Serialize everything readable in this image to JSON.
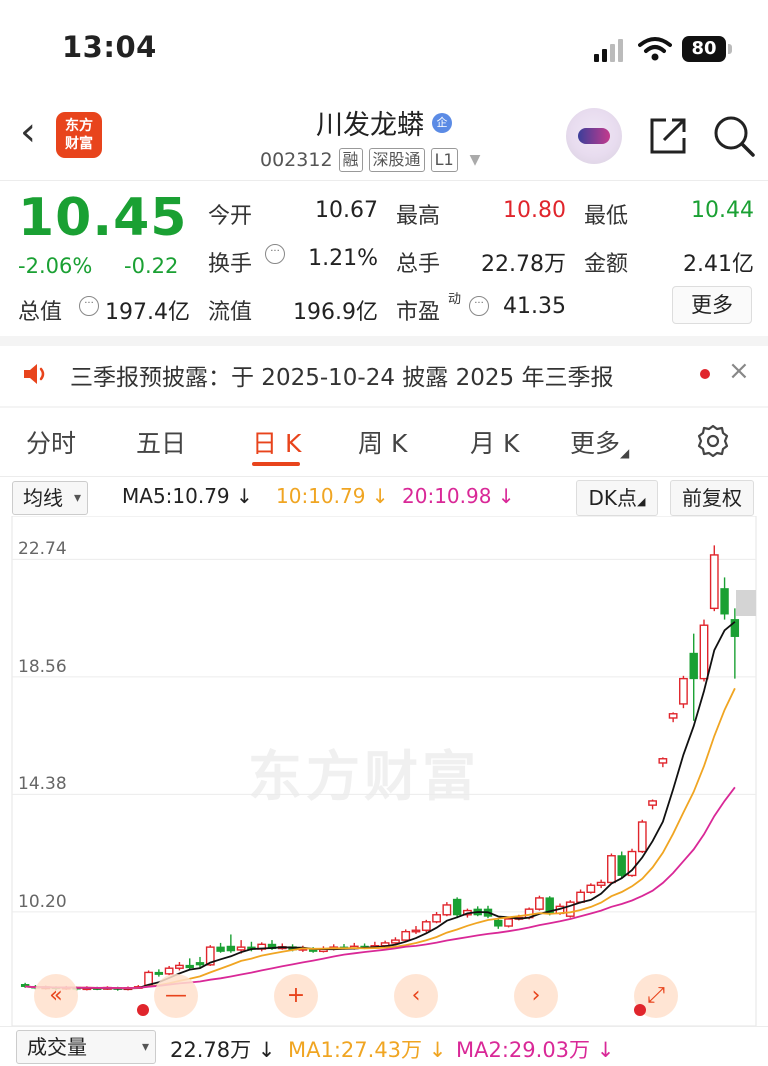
{
  "status": {
    "time": "13:04",
    "battery": "80"
  },
  "header": {
    "logo_text": "东方财富",
    "title": "川发龙蟒",
    "ent_badge": "企",
    "code": "002312",
    "tags": [
      "融",
      "深股通",
      "L1"
    ]
  },
  "quote": {
    "price": "10.45",
    "change_pct": "-2.06%",
    "change": "-0.22",
    "rows": [
      [
        {
          "label": "今开",
          "value": "10.67",
          "color": "#222222"
        },
        {
          "label": "最高",
          "value": "10.80",
          "color": "#e0252c"
        },
        {
          "label": "最低",
          "value": "10.44",
          "color": "#1aa033"
        }
      ],
      [
        {
          "label": "换手",
          "value": "1.21%",
          "color": "#222222"
        },
        {
          "label": "总手",
          "value": "22.78万",
          "color": "#222222"
        },
        {
          "label": "金额",
          "value": "2.41亿",
          "color": "#222222"
        }
      ],
      [
        {
          "label": "总值",
          "value": "197.4亿",
          "color": "#222222"
        },
        {
          "label": "流值",
          "value": "196.9亿",
          "color": "#222222"
        },
        {
          "label": "市盈",
          "value": "41.35",
          "color": "#222222"
        }
      ]
    ],
    "pe_sup": "动",
    "more_label": "更多"
  },
  "notice": {
    "text": "三季报预披露：于 2025-10-24 披露 2025 年三季报"
  },
  "tabs": [
    "分时",
    "五日",
    "日 K",
    "周 K",
    "月 K",
    "更多"
  ],
  "active_tab": "日 K",
  "ma_bar": {
    "selector": "均线",
    "ma5": "MA5:10.79",
    "ma10": "10:10.79",
    "ma20": "20:10.98",
    "dk": "DK点",
    "adjust": "前复权"
  },
  "chart_data": {
    "type": "candlestick",
    "y_ticks": [
      "22.74",
      "18.56",
      "14.38",
      "10.20"
    ],
    "ylim": [
      6.0,
      23.5
    ],
    "ma_colors": {
      "ma5": "#111111",
      "ma10": "#f0a522",
      "ma20": "#d92897"
    },
    "up_color": "#e0252c",
    "down_color": "#1aa033",
    "candles": [
      [
        7.12,
        7.05,
        7.18,
        7.0
      ],
      [
        7.05,
        7.0,
        7.1,
        6.95
      ],
      [
        7.0,
        7.03,
        7.08,
        6.94
      ],
      [
        7.03,
        6.98,
        7.06,
        6.92
      ],
      [
        6.98,
        7.02,
        7.07,
        6.93
      ],
      [
        7.02,
        6.96,
        7.05,
        6.9
      ],
      [
        6.96,
        7.0,
        7.06,
        6.91
      ],
      [
        7.0,
        6.97,
        7.04,
        6.92
      ],
      [
        6.97,
        7.01,
        7.06,
        6.93
      ],
      [
        7.01,
        6.95,
        7.04,
        6.9
      ],
      [
        6.95,
        7.0,
        7.05,
        6.91
      ],
      [
        7.0,
        7.04,
        7.1,
        6.96
      ],
      [
        7.1,
        7.55,
        7.62,
        7.05
      ],
      [
        7.55,
        7.48,
        7.66,
        7.4
      ],
      [
        7.5,
        7.7,
        7.78,
        7.45
      ],
      [
        7.7,
        7.8,
        7.92,
        7.62
      ],
      [
        7.8,
        7.72,
        8.05,
        7.65
      ],
      [
        7.9,
        7.82,
        8.1,
        7.7
      ],
      [
        7.82,
        8.45,
        8.52,
        7.78
      ],
      [
        8.45,
        8.3,
        8.6,
        8.25
      ],
      [
        8.48,
        8.32,
        8.9,
        8.25
      ],
      [
        8.35,
        8.45,
        8.7,
        8.22
      ],
      [
        8.45,
        8.38,
        8.64,
        8.3
      ],
      [
        8.38,
        8.55,
        8.62,
        8.3
      ],
      [
        8.55,
        8.4,
        8.7,
        8.35
      ],
      [
        8.4,
        8.46,
        8.58,
        8.36
      ],
      [
        8.46,
        8.35,
        8.55,
        8.3
      ],
      [
        8.35,
        8.4,
        8.5,
        8.28
      ],
      [
        8.4,
        8.3,
        8.45,
        8.25
      ],
      [
        8.3,
        8.38,
        8.48,
        8.26
      ],
      [
        8.38,
        8.45,
        8.55,
        8.33
      ],
      [
        8.45,
        8.4,
        8.56,
        8.36
      ],
      [
        8.4,
        8.48,
        8.6,
        8.36
      ],
      [
        8.48,
        8.42,
        8.58,
        8.38
      ],
      [
        8.42,
        8.5,
        8.64,
        8.4
      ],
      [
        8.5,
        8.6,
        8.68,
        8.45
      ],
      [
        8.6,
        8.7,
        8.8,
        8.55
      ],
      [
        8.7,
        9.0,
        9.08,
        8.64
      ],
      [
        9.0,
        9.05,
        9.2,
        8.92
      ],
      [
        9.05,
        9.35,
        9.42,
        8.98
      ],
      [
        9.35,
        9.6,
        9.7,
        9.3
      ],
      [
        9.6,
        9.95,
        10.05,
        9.55
      ],
      [
        10.15,
        9.6,
        10.22,
        9.48
      ],
      [
        9.6,
        9.75,
        9.82,
        9.5
      ],
      [
        9.8,
        9.6,
        9.9,
        9.55
      ],
      [
        9.8,
        9.55,
        9.92,
        9.48
      ],
      [
        9.4,
        9.2,
        9.48,
        9.1
      ],
      [
        9.2,
        9.45,
        9.52,
        9.15
      ],
      [
        9.45,
        9.5,
        9.6,
        9.4
      ],
      [
        9.5,
        9.8,
        9.86,
        9.44
      ],
      [
        9.8,
        10.2,
        10.28,
        9.75
      ],
      [
        10.2,
        9.65,
        10.26,
        9.58
      ],
      [
        9.65,
        9.9,
        10.0,
        9.6
      ],
      [
        9.55,
        10.05,
        10.12,
        9.5
      ],
      [
        10.05,
        10.4,
        10.5,
        10.0
      ],
      [
        10.4,
        10.65,
        10.72,
        10.35
      ],
      [
        10.65,
        10.75,
        10.85,
        10.55
      ],
      [
        10.75,
        11.7,
        11.78,
        10.7
      ],
      [
        11.7,
        11.0,
        11.85,
        10.9
      ],
      [
        11.0,
        11.85,
        11.95,
        10.95
      ],
      [
        11.85,
        12.9,
        12.98,
        11.8
      ],
      [
        13.5,
        13.65,
        13.7,
        13.35
      ],
      [
        15.0,
        15.15,
        15.2,
        14.85
      ],
      [
        16.6,
        16.75,
        16.8,
        16.45
      ],
      [
        17.1,
        18.0,
        18.1,
        16.95
      ],
      [
        18.9,
        18.0,
        19.6,
        16.5
      ],
      [
        18.0,
        19.9,
        20.1,
        17.9
      ],
      [
        20.5,
        22.4,
        22.74,
        20.4
      ],
      [
        21.2,
        20.3,
        21.6,
        20.1
      ],
      [
        20.1,
        19.5,
        20.5,
        18.0
      ]
    ]
  },
  "bottom_nav": [
    "«",
    "—",
    "+",
    "‹",
    "›",
    "⤢"
  ],
  "volume_bar": {
    "selector": "成交量",
    "vol": "22.78万",
    "ma1": "MA1:27.43万",
    "ma2": "MA2:29.03万"
  }
}
